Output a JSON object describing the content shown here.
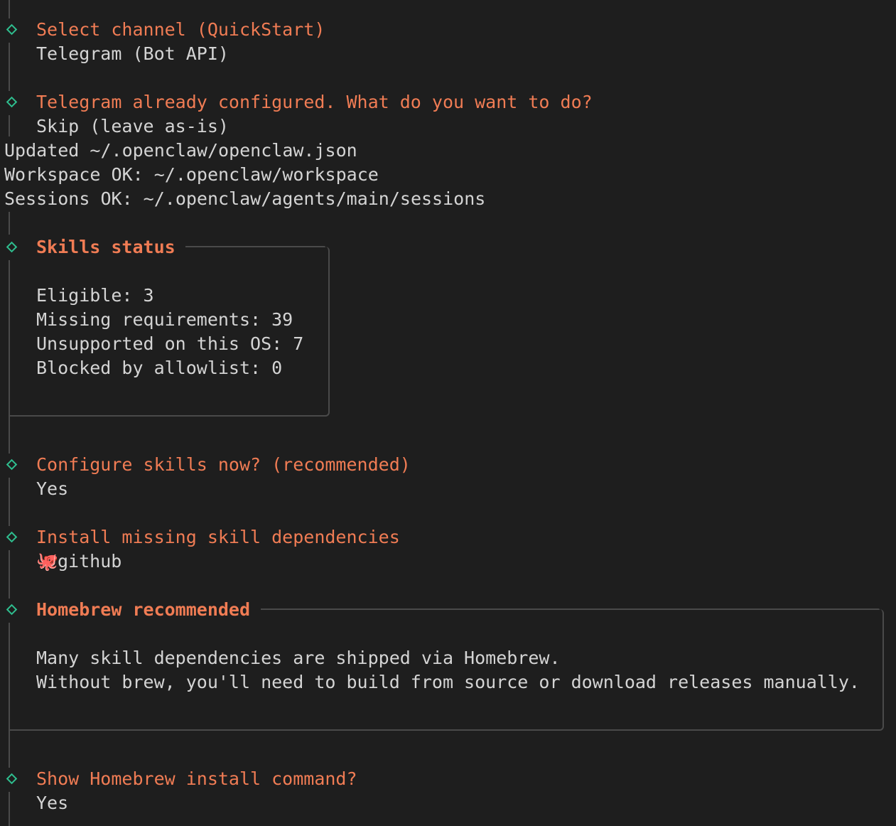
{
  "lines": {
    "select_channel_prompt": "Select channel (QuickStart)",
    "select_channel_answer": "Telegram (Bot API)",
    "telegram_prompt": "Telegram already configured. What do you want to do?",
    "telegram_answer": "Skip (leave as-is)",
    "updated": "Updated ~/.openclaw/openclaw.json",
    "workspace": "Workspace OK: ~/.openclaw/workspace",
    "sessions": "Sessions OK: ~/.openclaw/agents/main/sessions"
  },
  "skills_status": {
    "title": "Skills status",
    "eligible": "Eligible: 3",
    "missing": "Missing requirements: 39",
    "unsupported": "Unsupported on this OS: 7",
    "blocked": "Blocked by allowlist: 0"
  },
  "configure": {
    "prompt": "Configure skills now? (recommended)",
    "answer": "Yes"
  },
  "install": {
    "prompt": "Install missing skill dependencies",
    "icon": "octopus-icon",
    "answer": "github"
  },
  "homebrew_box": {
    "title": "Homebrew recommended",
    "line1": "Many skill dependencies are shipped via Homebrew.",
    "line2": "Without brew, you'll need to build from source or download releases manually."
  },
  "show_cmd": {
    "prompt": "Show Homebrew install command?",
    "answer": "Yes"
  },
  "colors": {
    "background": "#1e1e1e",
    "prompt": "#f07c54",
    "text": "#d4d4d4",
    "diamond": "#2fbf8f",
    "rail": "#4a4a4a"
  }
}
